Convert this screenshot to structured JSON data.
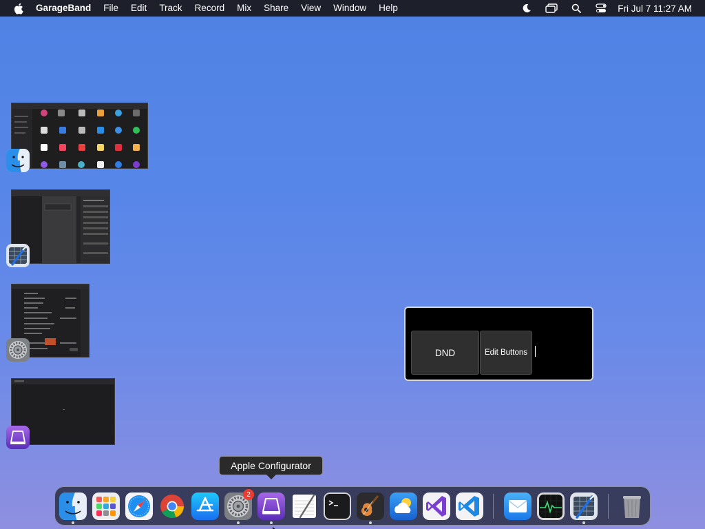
{
  "menubar": {
    "app_name": "GarageBand",
    "items": [
      "File",
      "Edit",
      "Track",
      "Record",
      "Mix",
      "Share",
      "View",
      "Window",
      "Help"
    ],
    "clock": "Fri Jul 7  11:27 AM",
    "status_icons": [
      "moon-icon",
      "screen-mirroring-icon",
      "spotlight-search-icon",
      "control-center-icon"
    ]
  },
  "thumbnails": [
    {
      "app": "Finder",
      "icon": "finder-icon"
    },
    {
      "app": "Xcode",
      "icon": "xcode-icon"
    },
    {
      "app": "System Settings",
      "icon": "system-settings-icon"
    },
    {
      "app": "Apple Configurator",
      "icon": "apple-configurator-icon"
    }
  ],
  "widget": {
    "dnd_label": "DND",
    "edit_label": "Edit Buttons"
  },
  "tooltip": {
    "text": "Apple Configurator"
  },
  "dock": {
    "badge_count": "2",
    "items": [
      {
        "name": "Finder",
        "icon": "finder-icon",
        "running": true
      },
      {
        "name": "Launchpad",
        "icon": "launchpad-icon",
        "running": false
      },
      {
        "name": "Safari",
        "icon": "safari-icon",
        "running": false
      },
      {
        "name": "Google Chrome",
        "icon": "chrome-icon",
        "running": false
      },
      {
        "name": "App Store",
        "icon": "app-store-icon",
        "running": false
      },
      {
        "name": "System Settings",
        "icon": "system-settings-icon",
        "running": true
      },
      {
        "name": "Apple Configurator",
        "icon": "apple-configurator-icon",
        "running": true
      },
      {
        "name": "TextEdit",
        "icon": "textedit-icon",
        "running": false
      },
      {
        "name": "Terminal",
        "icon": "terminal-icon",
        "running": false
      },
      {
        "name": "GarageBand",
        "icon": "garageband-icon",
        "running": true
      },
      {
        "name": "Weather",
        "icon": "weather-icon",
        "running": false
      },
      {
        "name": "Visual Studio",
        "icon": "visual-studio-icon",
        "running": false
      },
      {
        "name": "Visual Studio Code",
        "icon": "vscode-icon",
        "running": false
      },
      {
        "name": "Mail",
        "icon": "mail-icon",
        "running": false
      },
      {
        "name": "Activity Monitor",
        "icon": "activity-monitor-icon",
        "running": false
      },
      {
        "name": "Xcode",
        "icon": "xcode-icon",
        "running": true
      },
      {
        "name": "Trash",
        "icon": "trash-icon",
        "running": false
      }
    ]
  },
  "colors": {
    "badge": "#ec3b30",
    "desktop_top": "#4f82e4",
    "desktop_bottom": "#8f8fe0"
  }
}
